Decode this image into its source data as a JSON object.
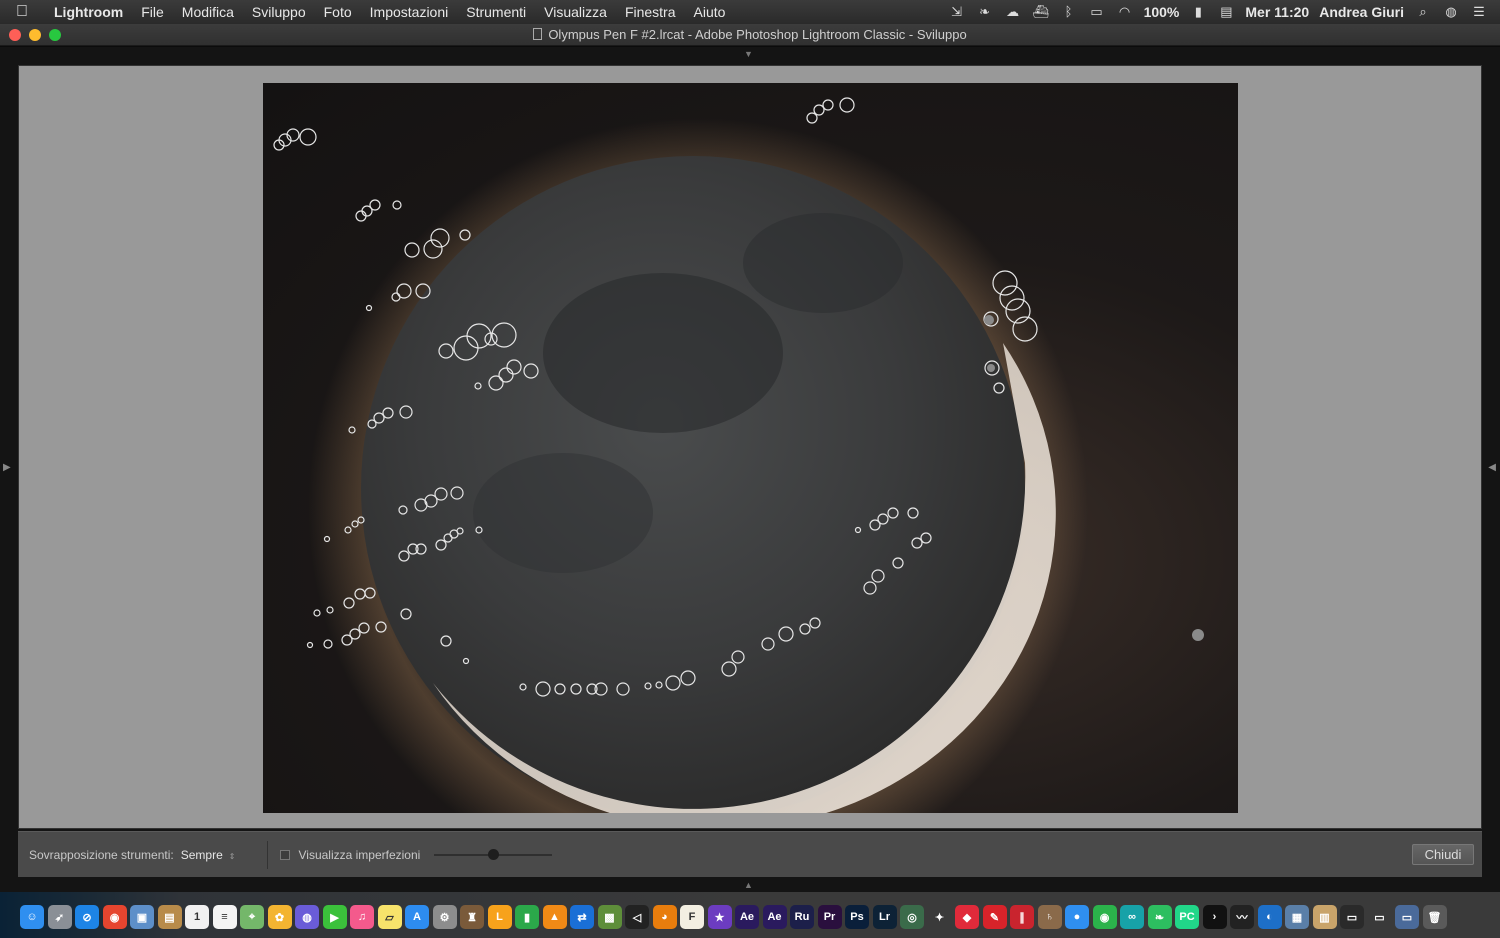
{
  "menubar": {
    "apple_icon": "apple-icon",
    "app_name": "Lightroom",
    "menus": [
      "File",
      "Modifica",
      "Sviluppo",
      "Foto",
      "Impostazioni",
      "Strumenti",
      "Visualizza",
      "Finestra",
      "Aiuto"
    ],
    "battery": "100%",
    "clock": "Mer 11:20",
    "user": "Andrea Giuri"
  },
  "window": {
    "title": "Olympus Pen F #2.lrcat - Adobe Photoshop Lightroom Classic - Sviluppo"
  },
  "toolbar": {
    "overlay_label": "Sovrapposizione strumenti:",
    "overlay_value": "Sempre",
    "visualize_spots_label": "Visualizza imperfezioni",
    "visualize_spots_checked": false,
    "threshold_level": 0.5,
    "close_label": "Chiudi"
  },
  "dock": {
    "apps": [
      {
        "name": "finder",
        "color": "#2f8ff0",
        "glyph": "☺"
      },
      {
        "name": "launchpad",
        "color": "#8a8f96",
        "glyph": "➶"
      },
      {
        "name": "safari",
        "color": "#1d84e6",
        "glyph": "⊘"
      },
      {
        "name": "chrome",
        "color": "#e5452f",
        "glyph": "◉"
      },
      {
        "name": "preview",
        "color": "#5d8fc9",
        "glyph": "▣"
      },
      {
        "name": "notes-book",
        "color": "#b88b4a",
        "glyph": "▤"
      },
      {
        "name": "calendar",
        "color": "#f1f1f1",
        "glyph": "1"
      },
      {
        "name": "textedit",
        "color": "#f4f4f4",
        "glyph": "≡"
      },
      {
        "name": "maps",
        "color": "#74b76a",
        "glyph": "⌖"
      },
      {
        "name": "photos",
        "color": "#f3b431",
        "glyph": "✿"
      },
      {
        "name": "siri",
        "color": "#6a5cd8",
        "glyph": "◍"
      },
      {
        "name": "facetime",
        "color": "#3bc13b",
        "glyph": "▶"
      },
      {
        "name": "itunes",
        "color": "#f45a8c",
        "glyph": "♫"
      },
      {
        "name": "stickies",
        "color": "#f7e36b",
        "glyph": "▱"
      },
      {
        "name": "app-store",
        "color": "#2d8cf0",
        "glyph": "A"
      },
      {
        "name": "system-preferences",
        "color": "#8d8d8d",
        "glyph": "⚙"
      },
      {
        "name": "instruments",
        "color": "#7a5a3a",
        "glyph": "♜"
      },
      {
        "name": "live",
        "color": "#f7a21b",
        "glyph": "L"
      },
      {
        "name": "numbers",
        "color": "#2ba84a",
        "glyph": "▮"
      },
      {
        "name": "vlc",
        "color": "#f08a16",
        "glyph": "▲"
      },
      {
        "name": "teamviewer",
        "color": "#1a6fd6",
        "glyph": "⇄"
      },
      {
        "name": "minecraft",
        "color": "#5e8e3a",
        "glyph": "▩"
      },
      {
        "name": "unity",
        "color": "#222222",
        "glyph": "◁"
      },
      {
        "name": "blender",
        "color": "#e87d0d",
        "glyph": "◕"
      },
      {
        "name": "fontforge",
        "color": "#f3efe2",
        "glyph": "F"
      },
      {
        "name": "imovie",
        "color": "#6c3cc0",
        "glyph": "★"
      },
      {
        "name": "after-effects",
        "color": "#2a1a5e",
        "glyph": "Ae"
      },
      {
        "name": "after-effects-2",
        "color": "#2a1a5e",
        "glyph": "Ae"
      },
      {
        "name": "rush",
        "color": "#1c1f4a",
        "glyph": "Ru"
      },
      {
        "name": "premiere",
        "color": "#2a0f3e",
        "glyph": "Pr"
      },
      {
        "name": "photoshop",
        "color": "#0a1f3a",
        "glyph": "Ps"
      },
      {
        "name": "lightroom",
        "color": "#0d2236",
        "glyph": "Lr"
      },
      {
        "name": "screen-capture",
        "color": "#3a6b4a",
        "glyph": "◎"
      },
      {
        "name": "telescope",
        "color": "#3a3a3a",
        "glyph": "✦"
      },
      {
        "name": "sketch",
        "color": "#e02a3a",
        "glyph": "◆"
      },
      {
        "name": "fontlab",
        "color": "#d8232a",
        "glyph": "✎"
      },
      {
        "name": "parallels",
        "color": "#c9242e",
        "glyph": "∥"
      },
      {
        "name": "saturn",
        "color": "#8a6a4a",
        "glyph": "♄"
      },
      {
        "name": "messages",
        "color": "#2f8ff0",
        "glyph": "●"
      },
      {
        "name": "camo",
        "color": "#2bb34b",
        "glyph": "◉"
      },
      {
        "name": "arduino",
        "color": "#17a2a8",
        "glyph": "∞"
      },
      {
        "name": "evernote",
        "color": "#2dbe60",
        "glyph": "❧"
      },
      {
        "name": "pycharm",
        "color": "#21d789",
        "glyph": "PC"
      },
      {
        "name": "terminal",
        "color": "#111111",
        "glyph": "›"
      },
      {
        "name": "activity-monitor",
        "color": "#222222",
        "glyph": "〰"
      },
      {
        "name": "camo-2",
        "color": "#1d6fc8",
        "glyph": "◐"
      },
      {
        "name": "network",
        "color": "#5a7fa8",
        "glyph": "▦"
      },
      {
        "name": "archive",
        "color": "#c9a46a",
        "glyph": "▥"
      },
      {
        "name": "window-1",
        "color": "#2a2a2a",
        "glyph": "▭"
      },
      {
        "name": "window-2",
        "color": "#3a3a3a",
        "glyph": "▭"
      },
      {
        "name": "window-3",
        "color": "#4a6a9a",
        "glyph": "▭"
      },
      {
        "name": "trash",
        "color": "#5a5a5a",
        "glyph": "🗑"
      }
    ]
  }
}
